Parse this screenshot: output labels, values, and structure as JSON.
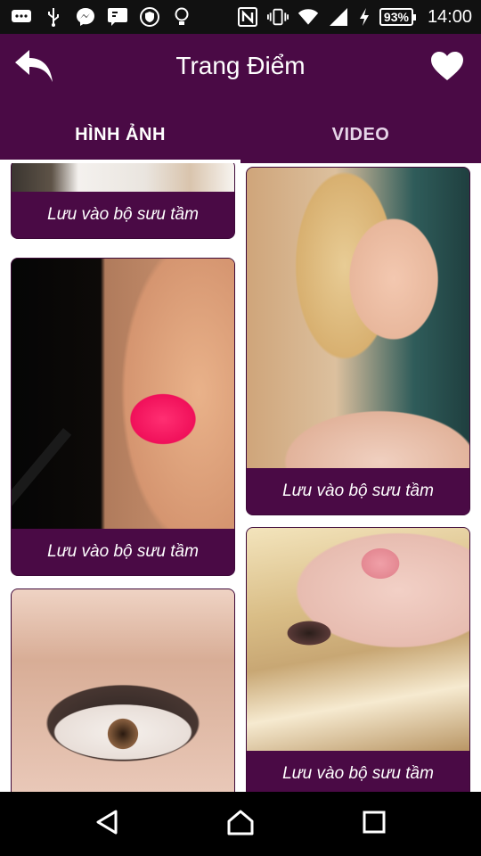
{
  "status_bar": {
    "battery": "93%",
    "time": "14:00",
    "icons": [
      "messaging-icon",
      "usb-icon",
      "messenger-icon",
      "message-icon",
      "shield-icon",
      "lightbulb-icon",
      "nfc-icon",
      "vibrate-icon",
      "wifi-icon",
      "signal-icon",
      "charging-icon"
    ]
  },
  "header": {
    "title": "Trang Điểm",
    "back_icon": "back-arrow-icon",
    "favorite_icon": "heart-icon",
    "background": "#4a0a45"
  },
  "tabs": [
    {
      "label": "HÌNH ẢNH",
      "active": true
    },
    {
      "label": "VIDEO",
      "active": false
    }
  ],
  "cards": {
    "left": [
      {
        "image": "hair-partial-image",
        "caption": "Lưu vào bộ sưu tầm"
      },
      {
        "image": "lipstick-brush-image",
        "caption": "Lưu vào bộ sưu tầm"
      },
      {
        "image": "smoky-eye-image",
        "caption": ""
      }
    ],
    "right": [
      {
        "image": "blonde-portrait-image",
        "caption": "Lưu vào bộ sưu tầm"
      },
      {
        "image": "blonde-lying-image",
        "caption": "Lưu vào bộ sưu tầm"
      }
    ]
  },
  "nav_bar": {
    "icons": [
      "back-triangle-icon",
      "home-icon",
      "recents-icon"
    ]
  }
}
